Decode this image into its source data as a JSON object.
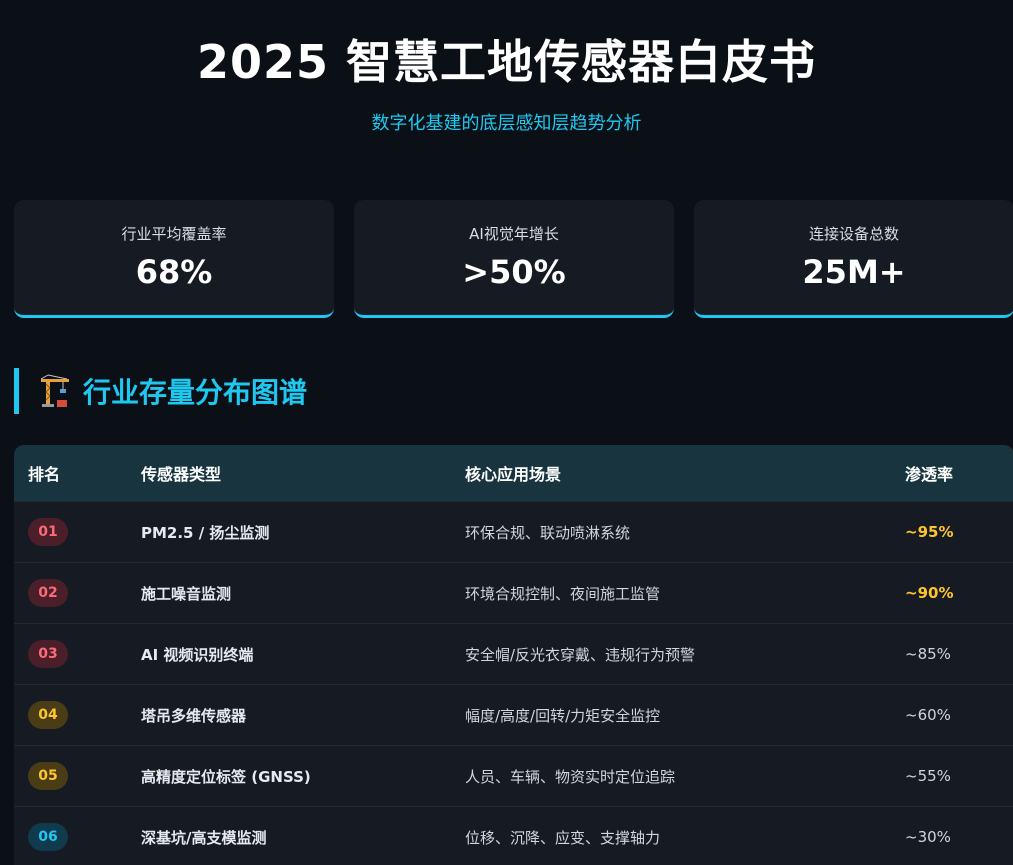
{
  "header": {
    "title": "2025 智慧工地传感器白皮书",
    "subtitle": "数字化基建的底层感知层趋势分析"
  },
  "stats": [
    {
      "label": "行业平均覆盖率",
      "value": "68%"
    },
    {
      "label": "AI视觉年增长",
      "value": ">50%"
    },
    {
      "label": "连接设备总数",
      "value": "25M+"
    }
  ],
  "section": {
    "icon": "crane-icon",
    "title": "行业存量分布图谱"
  },
  "table": {
    "headers": {
      "rank": "排名",
      "type": "传感器类型",
      "scene": "核心应用场景",
      "rate": "渗透率"
    },
    "rows": [
      {
        "rank": "01",
        "type": "PM2.5 / 扬尘监测",
        "scene": "环保合规、联动喷淋系统",
        "rate": "~95%"
      },
      {
        "rank": "02",
        "type": "施工噪音监测",
        "scene": "环境合规控制、夜间施工监管",
        "rate": "~90%"
      },
      {
        "rank": "03",
        "type": "AI 视频识别终端",
        "scene": "安全帽/反光衣穿戴、违规行为预警",
        "rate": "~85%"
      },
      {
        "rank": "04",
        "type": "塔吊多维传感器",
        "scene": "幅度/高度/回转/力矩安全监控",
        "rate": "~60%"
      },
      {
        "rank": "05",
        "type": "高精度定位标签 (GNSS)",
        "scene": "人员、车辆、物资实时定位追踪",
        "rate": "~55%"
      },
      {
        "rank": "06",
        "type": "深基坑/高支模监测",
        "scene": "位移、沉降、应变、支撑轴力",
        "rate": "~30%"
      }
    ]
  },
  "colors": {
    "accent": "#1ec8f0",
    "rank_red": "#ff6a78",
    "rank_yellow": "#ffc52e",
    "rank_blue": "#22c8f0",
    "highlight_rate": "#ffc52e"
  }
}
